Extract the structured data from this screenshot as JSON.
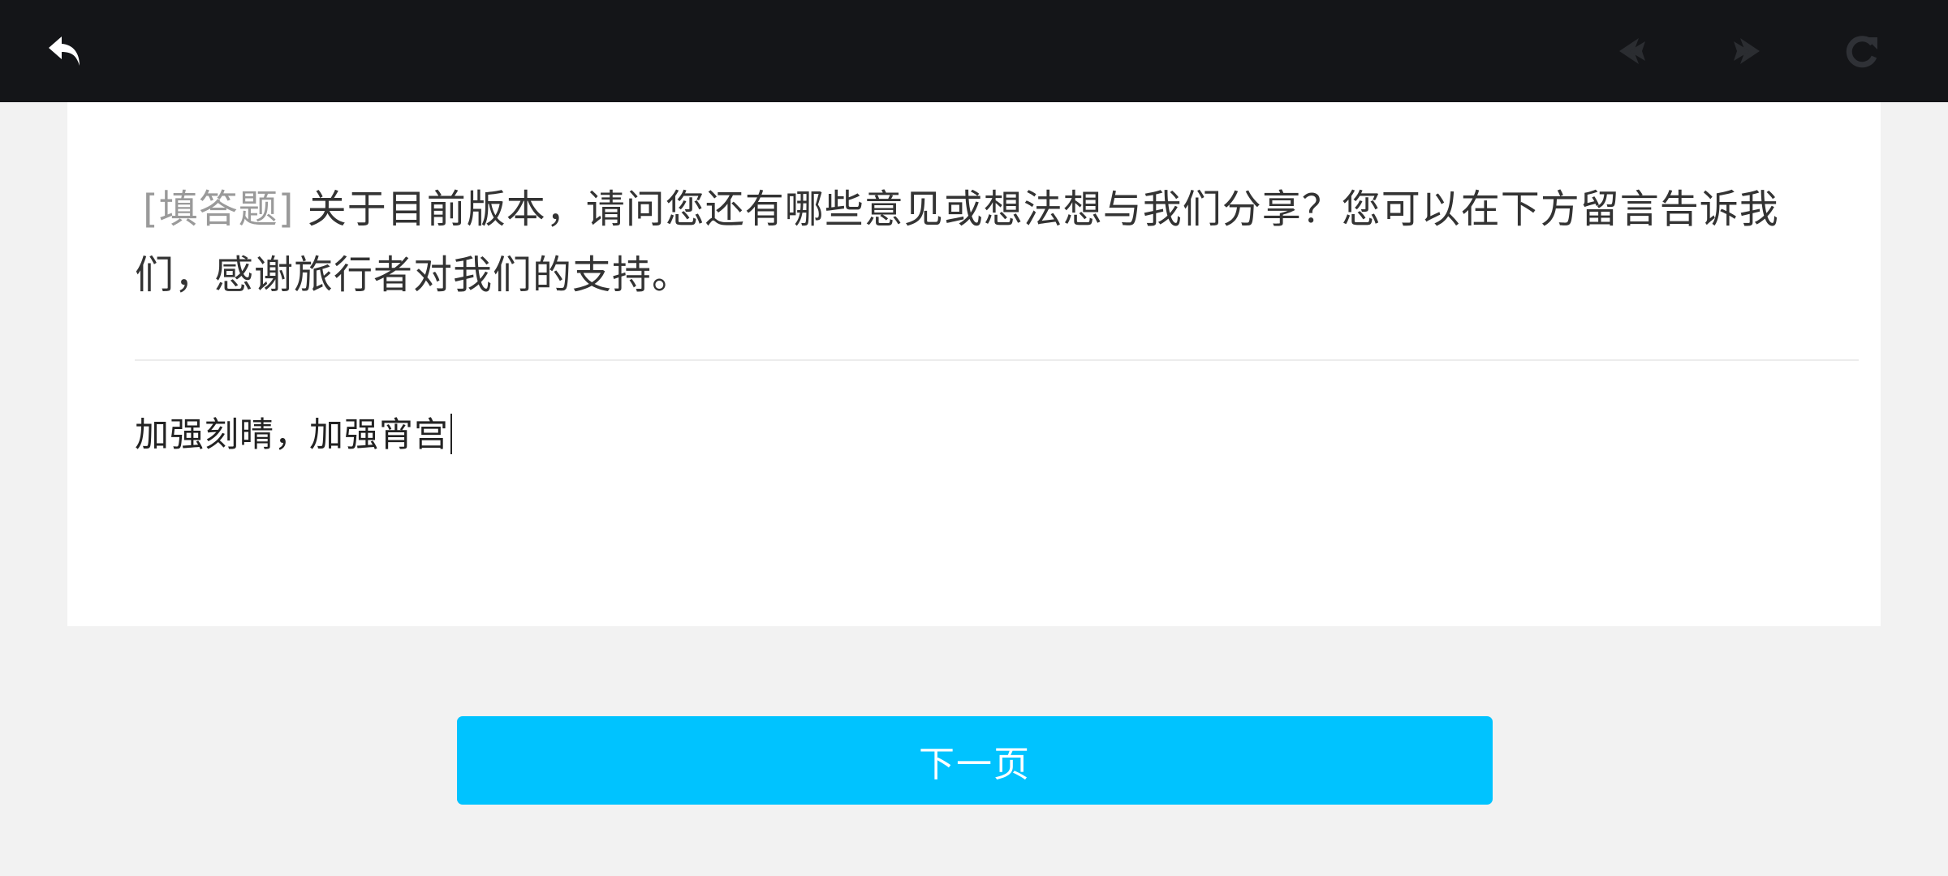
{
  "toolbar": {
    "back_icon": "undo-arrow-icon",
    "prev_icon": "arrow-left-icon",
    "next_icon": "arrow-right-icon",
    "refresh_icon": "refresh-icon"
  },
  "question": {
    "tag": "[填答题]",
    "text": "关于目前版本，请问您还有哪些意见或想法想与我们分享？您可以在下方留言告诉我们，感谢旅行者对我们的支持。"
  },
  "answer": {
    "value": "加强刻晴，加强宵宫"
  },
  "footer": {
    "next_page_label": "下一页"
  },
  "colors": {
    "topbar": "#141518",
    "accent": "#00c3ff",
    "background": "#f2f2f2"
  }
}
